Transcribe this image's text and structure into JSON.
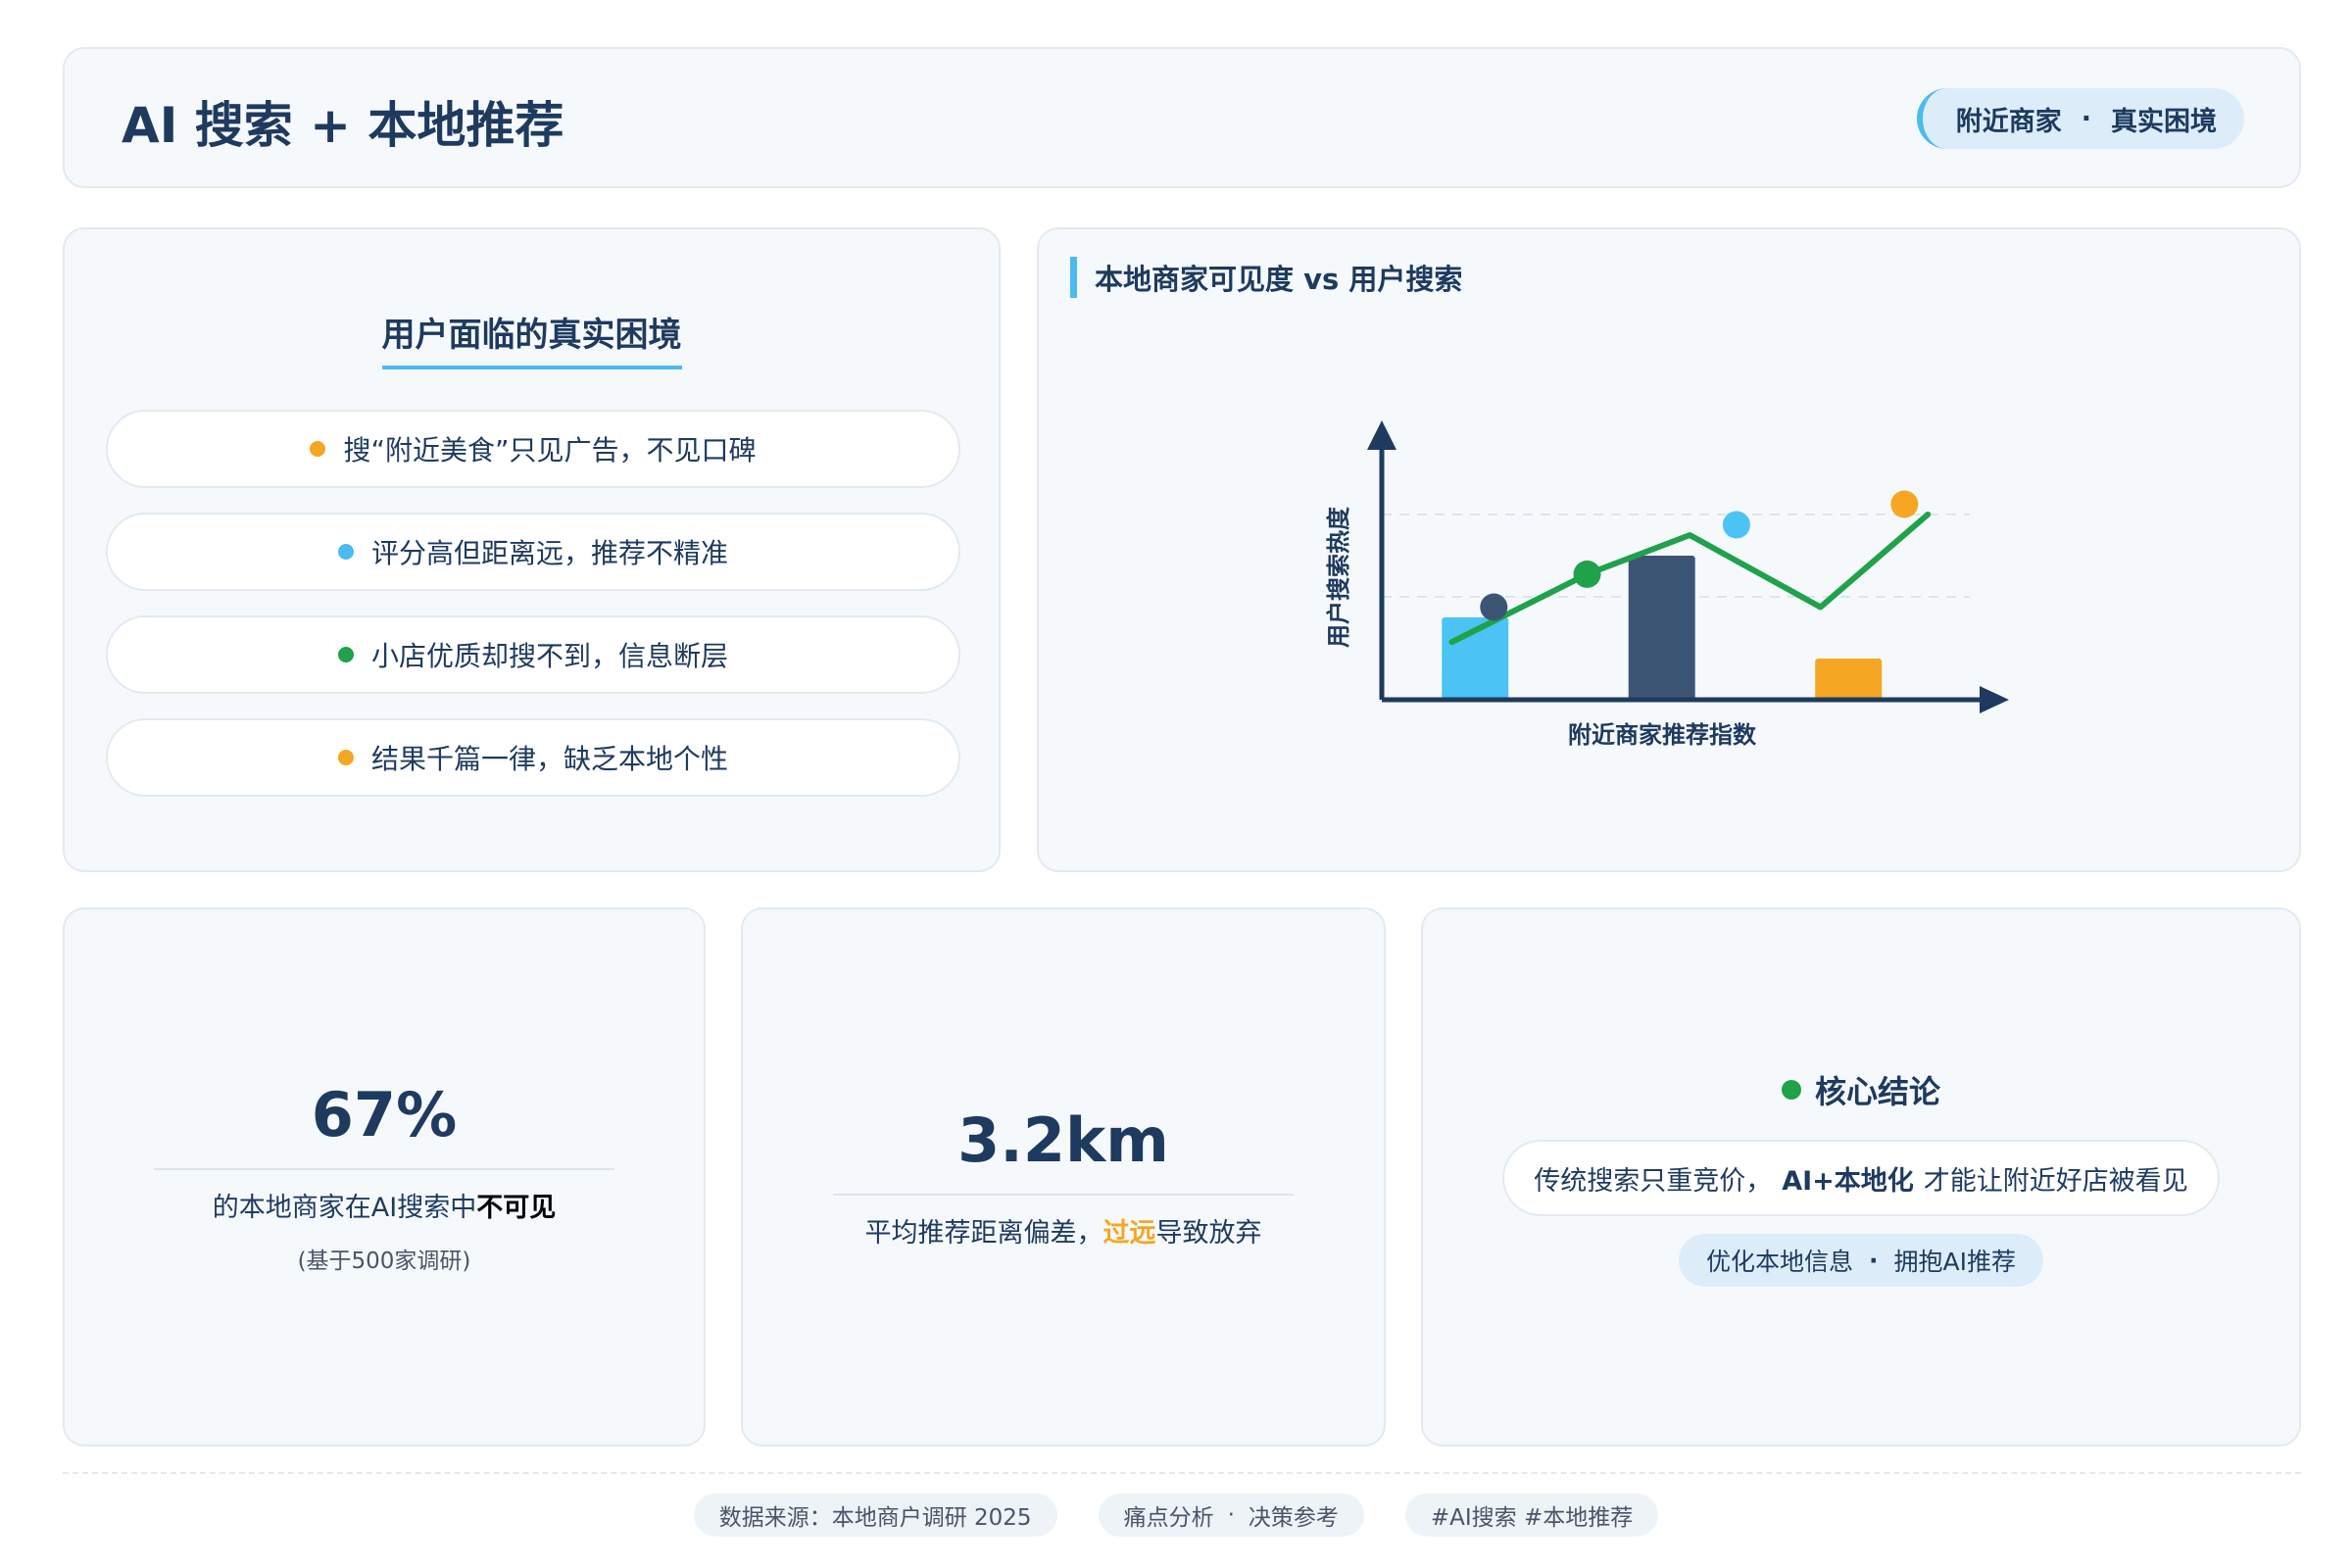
{
  "header": {
    "title": "AI 搜索 + 本地推荐",
    "badge_left": "附近商家",
    "badge_sep": "·",
    "badge_right": "真实困境"
  },
  "pain_points": {
    "title": "用户面临的真实困境",
    "items": [
      {
        "text": "搜“附近美食”只见广告，不见口碑",
        "color": "#f5a623"
      },
      {
        "text": "评分高但距离远，推荐不精准",
        "color": "#4bbaf0"
      },
      {
        "text": "小店优质却搜不到，信息断层",
        "color": "#1fa24a"
      },
      {
        "text": "结果千篇一律，缺乏本地个性",
        "color": "#f5a623"
      }
    ]
  },
  "chart_card": {
    "title": "本地商家可见度 vs 用户搜索"
  },
  "chart_data": {
    "type": "bar",
    "title": "",
    "xlabel": "附近商家推荐指数",
    "ylabel": "用户搜索热度",
    "ylim": [
      0,
      10
    ],
    "grid_values": [
      5,
      9
    ],
    "bars": [
      {
        "x": 1,
        "value": 4.0,
        "color": "#4bc3f5"
      },
      {
        "x": 3,
        "value": 7.0,
        "color": "#3d5575"
      },
      {
        "x": 5,
        "value": 2.0,
        "color": "#f5a623"
      }
    ],
    "line": {
      "color": "#1fa24a",
      "x": [
        0.75,
        2.2,
        3.3,
        4.7,
        5.85
      ],
      "y": [
        2.8,
        6.1,
        8.0,
        4.5,
        9.0
      ]
    },
    "markers": [
      {
        "x": 1.2,
        "y": 4.5,
        "color": "#3d5575"
      },
      {
        "x": 2.2,
        "y": 6.1,
        "color": "#1fa24a"
      },
      {
        "x": 3.8,
        "y": 8.5,
        "color": "#4bc3f5"
      },
      {
        "x": 5.6,
        "y": 9.5,
        "color": "#f5a623"
      }
    ],
    "xlim": [
      0,
      6.3
    ],
    "axis_color": "#1e3a5f",
    "grid": true
  },
  "stats": {
    "visibility": {
      "value": "67%",
      "desc_prefix": "的本地商家在AI搜索中",
      "desc_bold": "不可见",
      "note": "(基于500家调研)"
    },
    "distance": {
      "value": "3.2km",
      "desc_prefix": "平均推荐距离偏差，",
      "desc_highlight": "过远",
      "desc_suffix": "导致放弃"
    },
    "conclusion": {
      "title": "核心结论",
      "dot_color": "#1fa24a",
      "text_prefix": "传统搜索只重竞价，",
      "text_bold": "AI+本地化",
      "text_suffix": "才能让附近好店被看见",
      "tag_left": "优化本地信息",
      "tag_sep": "·",
      "tag_right": "拥抱AI推荐"
    }
  },
  "footer": {
    "source": "数据来源：本地商户调研 2025",
    "analysis_left": "痛点分析",
    "analysis_sep": "·",
    "analysis_right": "决策参考",
    "tags": "#AI搜索 #本地推荐"
  }
}
